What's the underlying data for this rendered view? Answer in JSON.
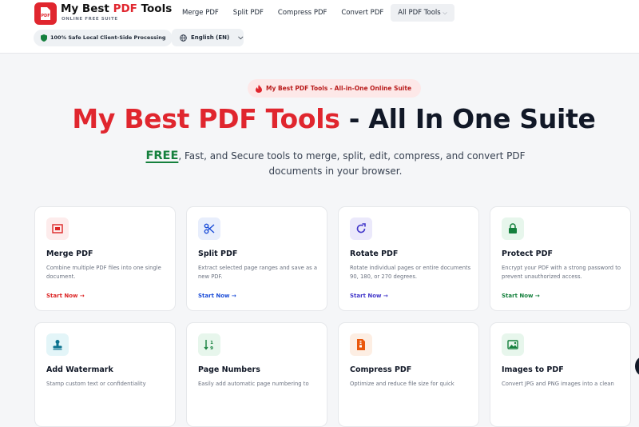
{
  "header": {
    "brand_main": "My Best ",
    "brand_accent": "PDF",
    "brand_tail": " Tools",
    "brand_sub": "ONLINE FREE SUITE",
    "logo_text": "PDF",
    "nav": [
      "Merge PDF",
      "Split PDF",
      "Compress PDF",
      "Convert PDF",
      "All PDF Tools"
    ],
    "safe_badge": "100% Safe Local Client-Side Processing",
    "language": "English (EN)"
  },
  "hero": {
    "pill": "My Best PDF Tools - All-in-One Online Suite",
    "title_red": "My Best PDF Tools",
    "title_dark": " - All In One Suite",
    "free": "FREE",
    "subtitle": ", Fast, and Secure tools to merge, split, edit, compress, and convert PDF documents in your browser."
  },
  "cards": [
    {
      "title": "Merge PDF",
      "desc": "Combine multiple PDF files into one single document.",
      "cta": "Start Now →",
      "icon": "merge-icon",
      "color": "#dc2626",
      "bg": "#fdecec"
    },
    {
      "title": "Split PDF",
      "desc": "Extract selected page ranges and save as a new PDF.",
      "cta": "Start Now →",
      "icon": "scissors-icon",
      "color": "#1d4ed8",
      "bg": "#e8eefc"
    },
    {
      "title": "Rotate PDF",
      "desc": "Rotate individual pages or entire documents 90, 180, or 270 degrees.",
      "cta": "Start Now →",
      "icon": "rotate-icon",
      "color": "#4338ca",
      "bg": "#ebe9fb"
    },
    {
      "title": "Protect PDF",
      "desc": "Encrypt your PDF with a strong password to prevent unauthorized access.",
      "cta": "Start Now →",
      "icon": "lock-icon",
      "color": "#15803d",
      "bg": "#e7f6ec"
    },
    {
      "title": "Add Watermark",
      "desc": "Stamp custom text or confidentiality",
      "icon": "stamp-icon",
      "color": "#0e7490",
      "bg": "#e3f5f8"
    },
    {
      "title": "Page Numbers",
      "desc": "Easily add automatic page numbering to",
      "icon": "sort-numbers-icon",
      "color": "#15803d",
      "bg": "#e7f6ec"
    },
    {
      "title": "Compress PDF",
      "desc": "Optimize and reduce file size for quick",
      "icon": "file-zip-icon",
      "color": "#ea580c",
      "bg": "#fdeee3"
    },
    {
      "title": "Images to PDF",
      "desc": "Convert JPG and PNG images into a clean",
      "icon": "image-icon",
      "color": "#15803d",
      "bg": "#e7f6ec"
    }
  ]
}
